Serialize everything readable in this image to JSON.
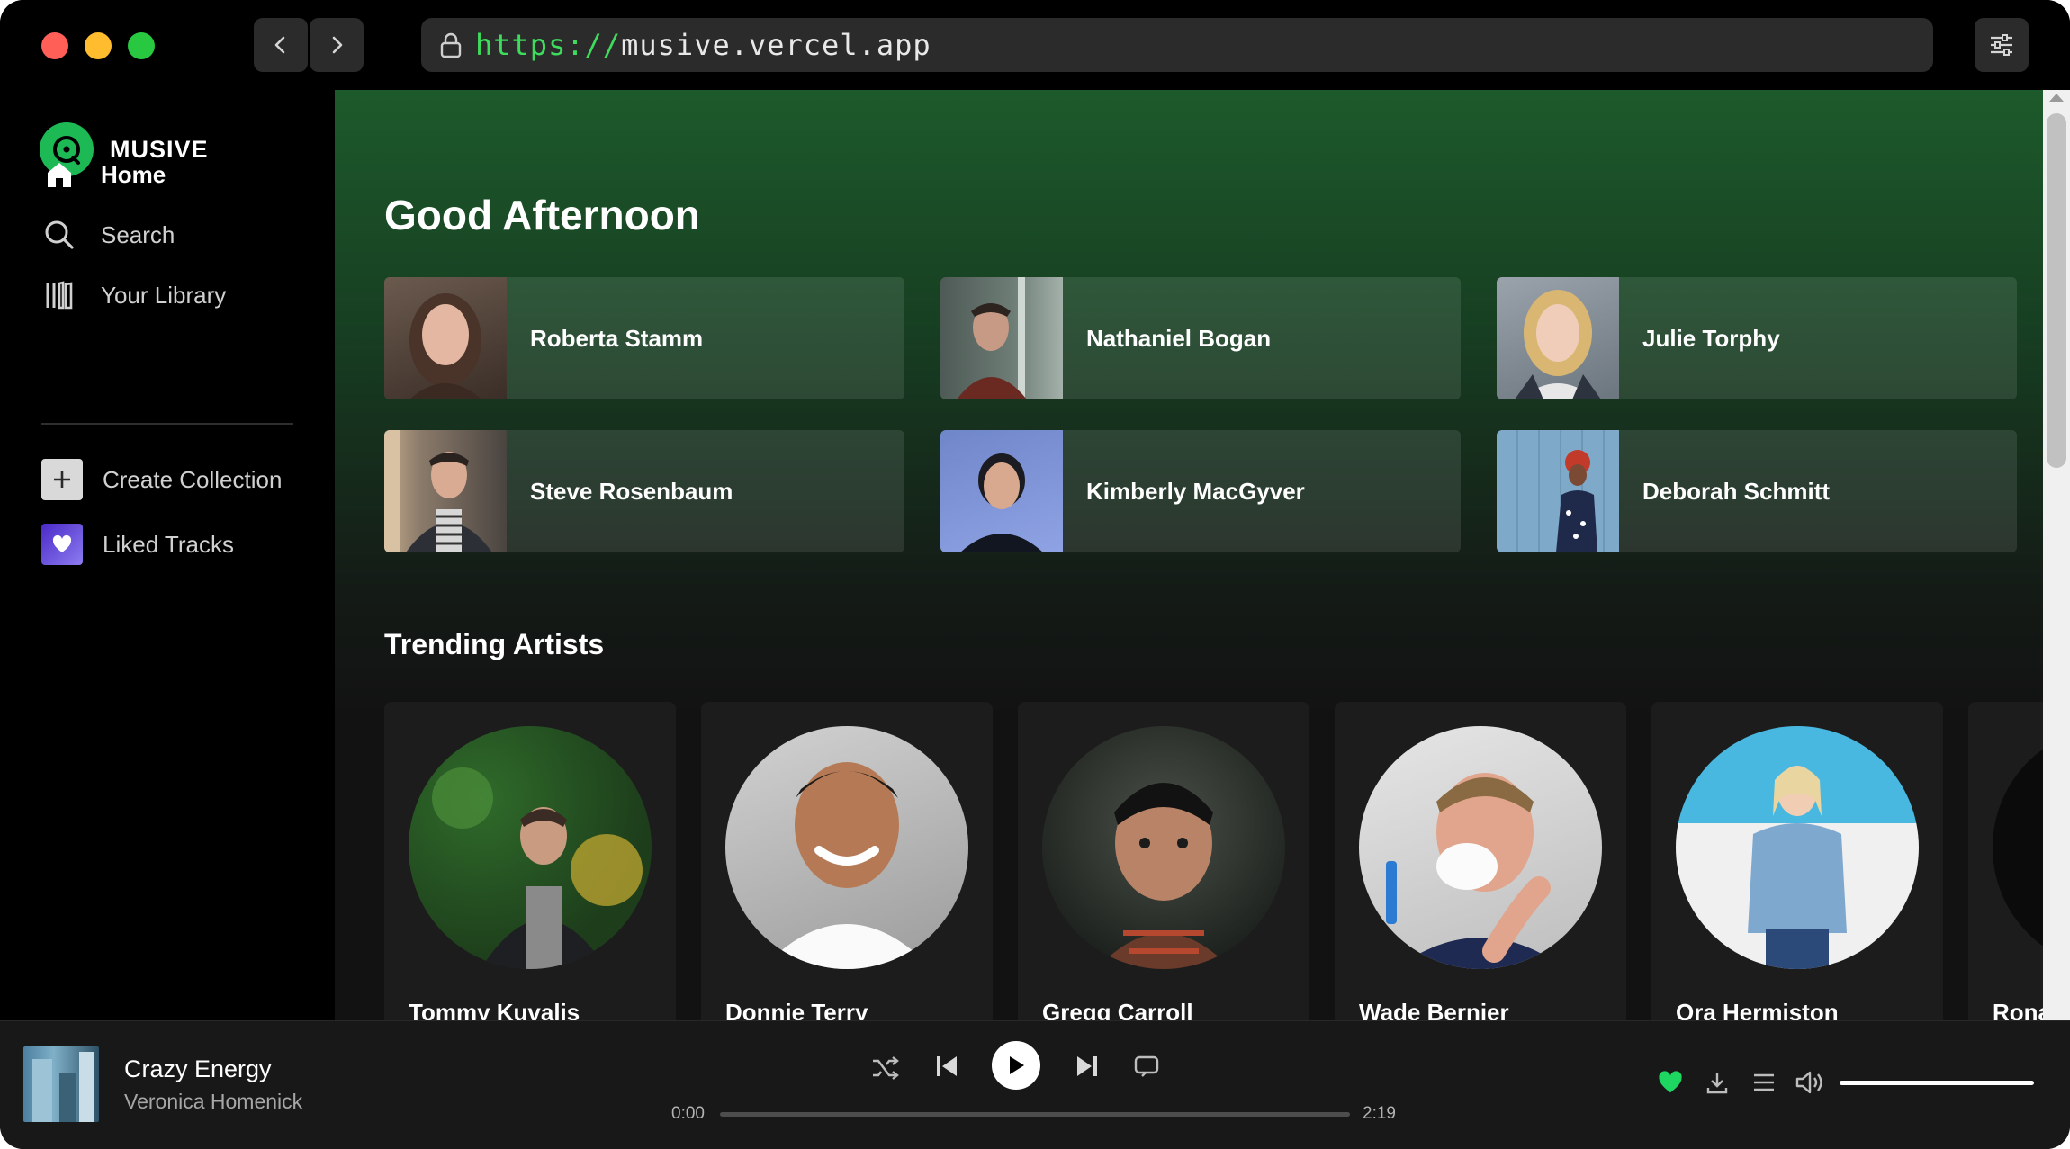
{
  "browser": {
    "url_scheme": "https://",
    "url_host": "musive.vercel.app"
  },
  "sidebar": {
    "brand": "MUSIVE",
    "nav": [
      {
        "label": "Home",
        "icon": "home-icon",
        "active": true
      },
      {
        "label": "Search",
        "icon": "search-icon",
        "active": false
      },
      {
        "label": "Your Library",
        "icon": "library-icon",
        "active": false
      }
    ],
    "collections": [
      {
        "label": "Create Collection",
        "icon": "plus-icon"
      },
      {
        "label": "Liked Tracks",
        "icon": "heart-icon"
      }
    ]
  },
  "main": {
    "greeting": "Good Afternoon",
    "quick_picks": [
      {
        "name": "Roberta Stamm"
      },
      {
        "name": "Nathaniel Bogan"
      },
      {
        "name": "Julie Torphy"
      },
      {
        "name": "Steve Rosenbaum"
      },
      {
        "name": "Kimberly MacGyver"
      },
      {
        "name": "Deborah Schmitt"
      }
    ],
    "trending_title": "Trending Artists",
    "trending_artists": [
      {
        "name": "Tommy Kuvalis"
      },
      {
        "name": "Donnie Terry"
      },
      {
        "name": "Gregg Carroll"
      },
      {
        "name": "Wade Bernier"
      },
      {
        "name": "Ora Hermiston"
      },
      {
        "name": "Ronal"
      }
    ]
  },
  "player": {
    "track_title": "Crazy Energy",
    "track_artist": "Veronica Homenick",
    "elapsed": "0:00",
    "duration": "2:19",
    "progress_fraction": 0,
    "volume_fraction": 1.0,
    "liked": true
  },
  "colors": {
    "accent": "#1db954",
    "liked_heart": "#1ed760",
    "url_scheme": "#3ddc5c"
  }
}
